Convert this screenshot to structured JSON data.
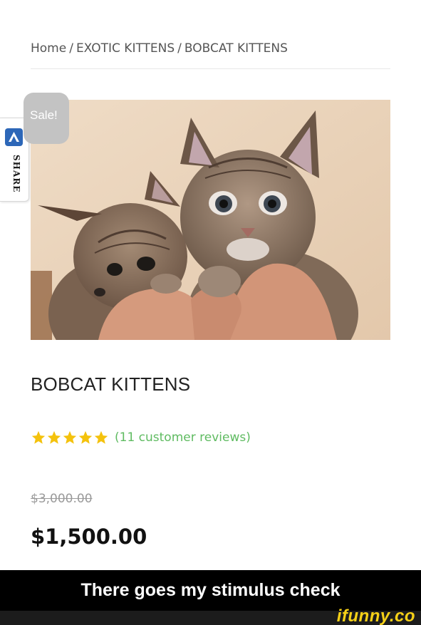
{
  "breadcrumb": {
    "items": [
      "Home",
      "EXOTIC KITTENS",
      "BOBCAT KITTENS"
    ],
    "separator": "/"
  },
  "share": {
    "label": "SHARE",
    "icon": "share-logo-icon"
  },
  "product": {
    "badge": "Sale!",
    "image_alt": "two bobcat kittens held in hands",
    "title": "BOBCAT KITTENS",
    "rating": 5,
    "reviews": "(11 customer reviews)",
    "old_price": "$3,000.00",
    "price": "$1,500.00"
  },
  "caption": "There goes my stimulus check",
  "watermark": "ifunny.co",
  "colors": {
    "star": "#f4c20d",
    "reviews_link": "#5fbb61",
    "sale_badge": "#c3c3c3",
    "share_logo": "#2d67b8",
    "watermark": "#f7d117"
  }
}
